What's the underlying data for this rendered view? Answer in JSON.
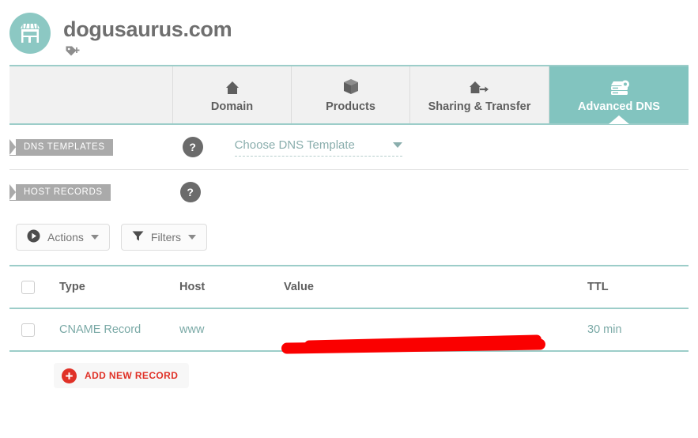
{
  "header": {
    "domain": "dogusaurus.com",
    "logo_icon": "storefront-icon",
    "tag_icon": "tag-plus-icon"
  },
  "tabs": [
    {
      "label": "",
      "icon": "",
      "active": false
    },
    {
      "label": "Domain",
      "icon": "house-icon",
      "active": false
    },
    {
      "label": "Products",
      "icon": "box-icon",
      "active": false
    },
    {
      "label": "Sharing & Transfer",
      "icon": "house-arrow-icon",
      "active": false
    },
    {
      "label": "Advanced DNS",
      "icon": "server-gear-icon",
      "active": true
    }
  ],
  "dns_templates": {
    "ribbon_label": "DNS TEMPLATES",
    "help_label": "?",
    "select_value": "Choose DNS Template"
  },
  "host_records": {
    "ribbon_label": "HOST RECORDS",
    "help_label": "?"
  },
  "toolbar": {
    "actions_label": "Actions",
    "filters_label": "Filters"
  },
  "table": {
    "columns": [
      "Type",
      "Host",
      "Value",
      "TTL"
    ],
    "rows": [
      {
        "type": "CNAME Record",
        "host": "www",
        "value": "",
        "value_redacted": true,
        "ttl": "30 min"
      }
    ]
  },
  "add_record": {
    "label": "ADD NEW RECORD",
    "icon": "plus-circle-icon"
  },
  "colors": {
    "teal": "#82c4bf",
    "teal_rule": "#9ccdc9",
    "text_grey": "#5f5f5f",
    "link_teal": "#7aa9a6",
    "red": "#e03127",
    "redaction": "#fa0000",
    "ribbon_grey": "#aaaaaa"
  }
}
